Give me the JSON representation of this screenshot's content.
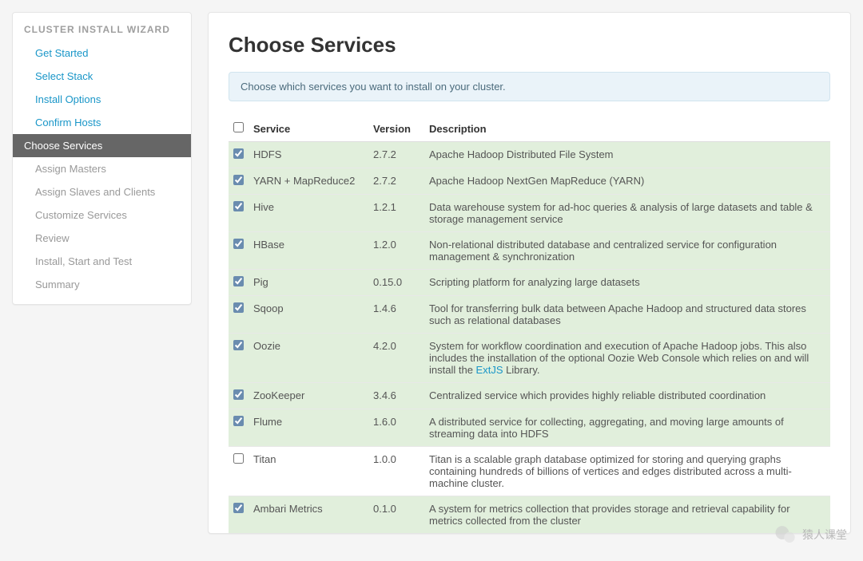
{
  "sidebar": {
    "title": "CLUSTER INSTALL WIZARD",
    "steps": [
      {
        "label": "Get Started",
        "state": "completed"
      },
      {
        "label": "Select Stack",
        "state": "completed"
      },
      {
        "label": "Install Options",
        "state": "completed"
      },
      {
        "label": "Confirm Hosts",
        "state": "completed"
      },
      {
        "label": "Choose Services",
        "state": "active"
      },
      {
        "label": "Assign Masters",
        "state": "upcoming"
      },
      {
        "label": "Assign Slaves and Clients",
        "state": "upcoming"
      },
      {
        "label": "Customize Services",
        "state": "upcoming"
      },
      {
        "label": "Review",
        "state": "upcoming"
      },
      {
        "label": "Install, Start and Test",
        "state": "upcoming"
      },
      {
        "label": "Summary",
        "state": "upcoming"
      }
    ]
  },
  "page": {
    "title": "Choose Services",
    "hint": "Choose which services you want to install on your cluster."
  },
  "table": {
    "headers": {
      "service": "Service",
      "version": "Version",
      "description": "Description"
    },
    "rows": [
      {
        "checked": true,
        "name": "HDFS",
        "version": "2.7.2",
        "description": "Apache Hadoop Distributed File System"
      },
      {
        "checked": true,
        "name": "YARN + MapReduce2",
        "version": "2.7.2",
        "description": "Apache Hadoop NextGen MapReduce (YARN)"
      },
      {
        "checked": true,
        "name": "Hive",
        "version": "1.2.1",
        "description": "Data warehouse system for ad-hoc queries & analysis of large datasets and table & storage management service"
      },
      {
        "checked": true,
        "name": "HBase",
        "version": "1.2.0",
        "description": "Non-relational distributed database and centralized service for configuration management & synchronization"
      },
      {
        "checked": true,
        "name": "Pig",
        "version": "0.15.0",
        "description": "Scripting platform for analyzing large datasets"
      },
      {
        "checked": true,
        "name": "Sqoop",
        "version": "1.4.6",
        "description": "Tool for transferring bulk data between Apache Hadoop and structured data stores such as relational databases"
      },
      {
        "checked": true,
        "name": "Oozie",
        "version": "4.2.0",
        "description_pre": "System for workflow coordination and execution of Apache Hadoop jobs. This also includes the installation of the optional Oozie Web Console which relies on and will install the ",
        "link_text": "ExtJS",
        "description_post": " Library."
      },
      {
        "checked": true,
        "name": "ZooKeeper",
        "version": "3.4.6",
        "description": "Centralized service which provides highly reliable distributed coordination"
      },
      {
        "checked": true,
        "name": "Flume",
        "version": "1.6.0",
        "description": "A distributed service for collecting, aggregating, and moving large amounts of streaming data into HDFS"
      },
      {
        "checked": false,
        "name": "Titan",
        "version": "1.0.0",
        "description": "Titan is a scalable graph database optimized for storing and querying graphs containing hundreds of billions of vertices and edges distributed across a multi-machine cluster."
      },
      {
        "checked": true,
        "name": "Ambari Metrics",
        "version": "0.1.0",
        "description": "A system for metrics collection that provides storage and retrieval capability for metrics collected from the cluster"
      }
    ]
  },
  "watermark": {
    "text": "猿人课堂"
  }
}
